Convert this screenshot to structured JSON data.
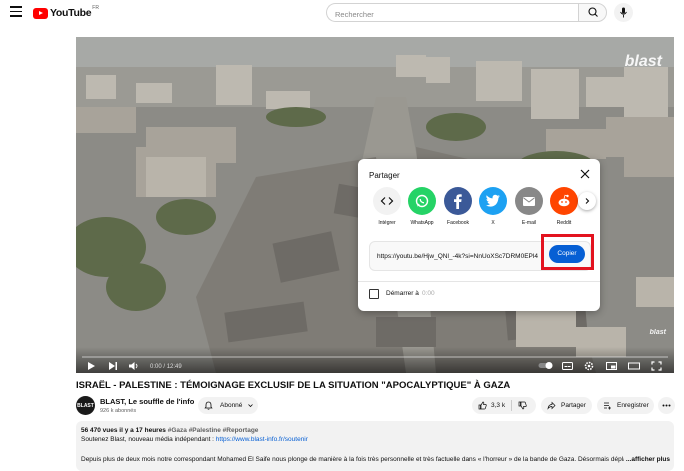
{
  "header": {
    "logo_text": "YouTube",
    "country_code": "FR",
    "search_placeholder": "Rechercher",
    "icons": [
      "menu-icon",
      "youtube-logo-icon",
      "search-icon",
      "mic-icon"
    ]
  },
  "video": {
    "watermark": "blast",
    "watermark_small": "blast",
    "time_current": "0:00",
    "time_total": "12:49",
    "progress": 0.0,
    "controls": [
      "play-icon",
      "next-icon",
      "volume-icon",
      "autoplay-toggle",
      "subtitles-icon",
      "settings-icon",
      "miniplayer-icon",
      "theater-icon",
      "fullscreen-icon"
    ]
  },
  "share_dialog": {
    "title": "Partager",
    "targets": [
      {
        "label": "Intégrer",
        "icon": "embed-icon",
        "color": "#f2f2f2"
      },
      {
        "label": "WhatsApp",
        "icon": "whatsapp-icon",
        "color": "#25d366"
      },
      {
        "label": "Facebook",
        "icon": "facebook-icon",
        "color": "#3b5998"
      },
      {
        "label": "X",
        "icon": "x-icon",
        "color": "#1da1f2"
      },
      {
        "label": "E-mail",
        "icon": "email-icon",
        "color": "#888888"
      },
      {
        "label": "Reddit",
        "icon": "reddit-icon",
        "color": "#ff4500"
      }
    ],
    "url": "https://youtu.be/Hjw_QNl_-4k?si=NnUoXSc7DRM0EPl4",
    "copy_label": "Copier",
    "start_label": "Démarrer à",
    "start_time": "0:00"
  },
  "below_video": {
    "title": "ISRAËL - PALESTINE : TÉMOIGNAGE EXCLUSIF DE LA SITUATION \"APOCALYPTIQUE\" À GAZA",
    "avatar_text": "BLAST",
    "channel_name": "BLAST, Le souffle de l'info",
    "subscribers": "926 k abonnés",
    "subscribe_label": "Abonné",
    "likes": "3,3 k",
    "share_label": "Partager",
    "save_label": "Enregistrer"
  },
  "description": {
    "stats": "56 470 vues  il y a 17 heures",
    "hashtags": "#Gaza #Palestine #Reportage",
    "line2_prefix": "Soutenez Blast, nouveau média indépendant : ",
    "line2_link": "https://www.blast-info.fr/soutenir",
    "line3": "Depuis plus de deux mois notre correspondant Mohamed El Saife nous plonge de manière à la fois très personnelle et très factuelle dans « l'horreur » de la bande de Gaza. Désormais déplac",
    "more_label": "...afficher plus"
  },
  "colors": {
    "youtube_red": "#ff0000",
    "copy_blue": "#065fd4",
    "highlight_red": "#e3131f"
  }
}
